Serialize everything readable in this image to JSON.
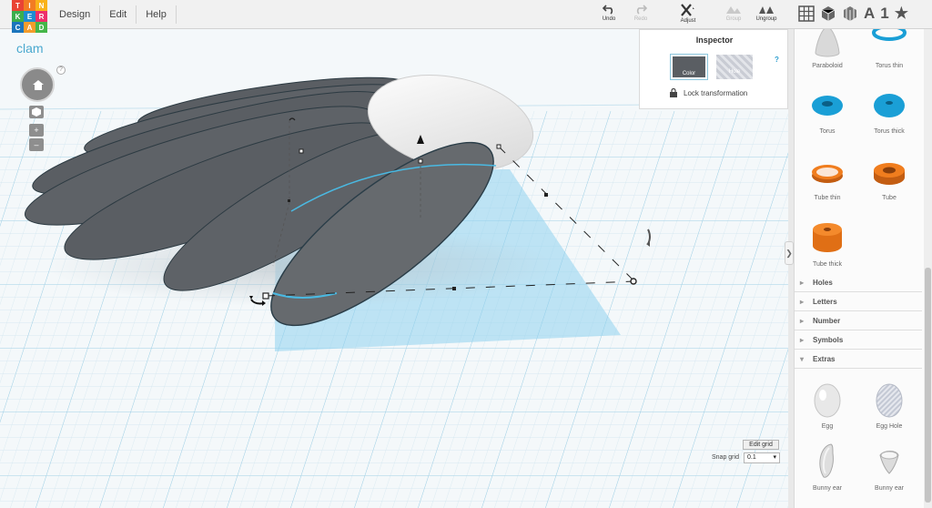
{
  "app": {
    "logo_letters": [
      "T",
      "I",
      "N",
      "K",
      "E",
      "R",
      "C",
      "A",
      "D"
    ],
    "logo_colors": [
      "#e94335",
      "#f27c23",
      "#f9b21a",
      "#3cae4d",
      "#1d8dd1",
      "#ed2f6b",
      "#1b75bc",
      "#f39c2b",
      "#45b649"
    ]
  },
  "menu": [
    {
      "label": "Design"
    },
    {
      "label": "Edit"
    },
    {
      "label": "Help"
    }
  ],
  "toolbar": {
    "undo": "Undo",
    "redo": "Redo",
    "adjust": "Adjust",
    "group": "Group",
    "ungroup": "Ungroup"
  },
  "view_buttons": {
    "text_icon": "A",
    "number_icon": "1",
    "star_icon": "★"
  },
  "design": {
    "title": "clam"
  },
  "viewcube": {
    "help": "?",
    "zoom_in": "+",
    "zoom_out": "–"
  },
  "inspector": {
    "title": "Inspector",
    "help": "?",
    "color_label": "Color",
    "hole_label": "Hole",
    "lock_label": "Lock transformation"
  },
  "grid": {
    "edit_label": "Edit grid",
    "snap_label": "Snap grid",
    "snap_value": "0.1"
  },
  "shapes_top": [
    {
      "label": "Paraboloid",
      "icon": "paraboloid-icon"
    },
    {
      "label": "Torus thin",
      "icon": "torus-thin-icon"
    },
    {
      "label": "Torus",
      "icon": "torus-icon"
    },
    {
      "label": "Torus thick",
      "icon": "torus-thick-icon"
    },
    {
      "label": "Tube thin",
      "icon": "tube-thin-icon"
    },
    {
      "label": "Tube",
      "icon": "tube-icon"
    },
    {
      "label": "Tube thick",
      "icon": "tube-thick-icon"
    }
  ],
  "sections": [
    {
      "label": "Holes"
    },
    {
      "label": "Letters"
    },
    {
      "label": "Number"
    },
    {
      "label": "Symbols"
    },
    {
      "label": "Extras"
    }
  ],
  "shapes_extras": [
    {
      "label": "Egg",
      "icon": "egg-icon"
    },
    {
      "label": "Egg Hole",
      "icon": "egg-hole-icon"
    },
    {
      "label": "Bunny ear",
      "icon": "bunny-ear-icon"
    },
    {
      "label": "Bunny ear",
      "icon": "bunny-ear-hole-icon"
    }
  ],
  "colors": {
    "accent": "#4aa9cf",
    "shape_gray": "#5e6165",
    "orange": "#f07d1e",
    "blue": "#19a3d9"
  }
}
